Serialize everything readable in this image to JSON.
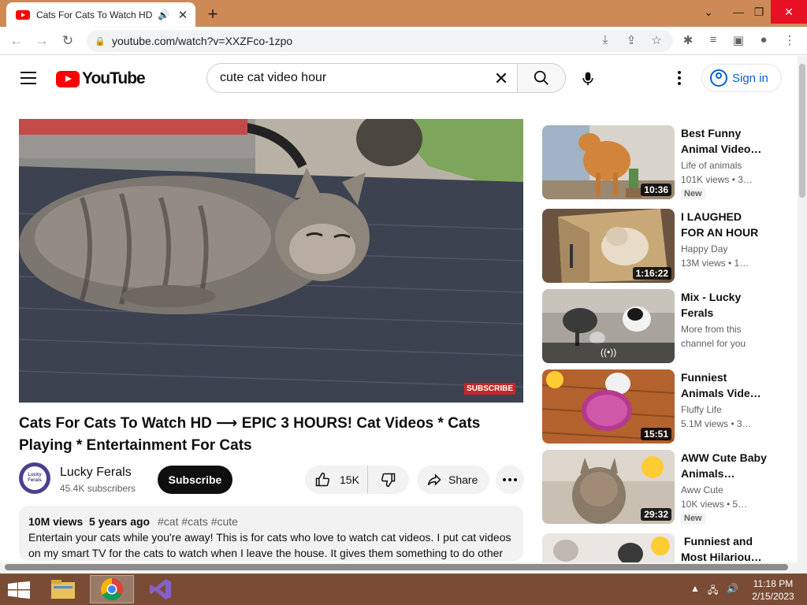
{
  "browser": {
    "tab_title": "Cats For Cats To Watch HD ~",
    "url": "youtube.com/watch?v=XXZFco-1zpo"
  },
  "youtube": {
    "logo_text": "YouTube",
    "search_query": "cute cat video hour",
    "signin_label": "Sign in"
  },
  "video": {
    "title": "Cats For Cats To Watch HD ⟶ EPIC 3 HOURS! Cat Videos * Cats Playing * Entertainment For Cats",
    "watermark": "SUBSCRIBE",
    "channel_name": "Lucky Ferals",
    "avatar_text": "Lucky Ferals",
    "subscribers": "45.4K subscribers",
    "subscribe_label": "Subscribe",
    "likes": "15K",
    "share_label": "Share",
    "views": "10M views",
    "age": "5 years ago",
    "hashtags": "#cat #cats #cute",
    "description": "Entertain your cats while you're away! This is for cats who love to watch cat videos. I put cat videos on my smart TV for the cats to watch when I leave the house. It gives them something to do other"
  },
  "recommendations": [
    {
      "title": "Best Funny Animal Video…",
      "channel": "Life of animals",
      "stats": "101K views  • 3…",
      "duration": "10:36",
      "badge": "New"
    },
    {
      "title": "I LAUGHED FOR AN HOUR😹…",
      "channel": "Happy Day",
      "stats": "13M views  • 1…",
      "duration": "1:16:22"
    },
    {
      "title": "Mix - Lucky Ferals",
      "channel": "More from this",
      "stats": "channel for you"
    },
    {
      "title": "Funniest Animals Vide…",
      "channel": "Fluffy Life",
      "stats": "5.1M views  • 3…",
      "duration": "15:51"
    },
    {
      "title": "AWW Cute Baby Animals…",
      "channel": "Aww Cute",
      "stats": "10K views  • 5…",
      "duration": "29:32",
      "badge": "New"
    },
    {
      "title": "󠁿 Funniest and Most Hilariou…"
    }
  ],
  "taskbar": {
    "time": "11:18 PM",
    "date": "2/15/2023"
  },
  "colors": {
    "youtube_red": "#ff0000",
    "link_blue": "#065fd4",
    "tabbar": "#cd8a57",
    "taskbar": "#7a4c36"
  }
}
